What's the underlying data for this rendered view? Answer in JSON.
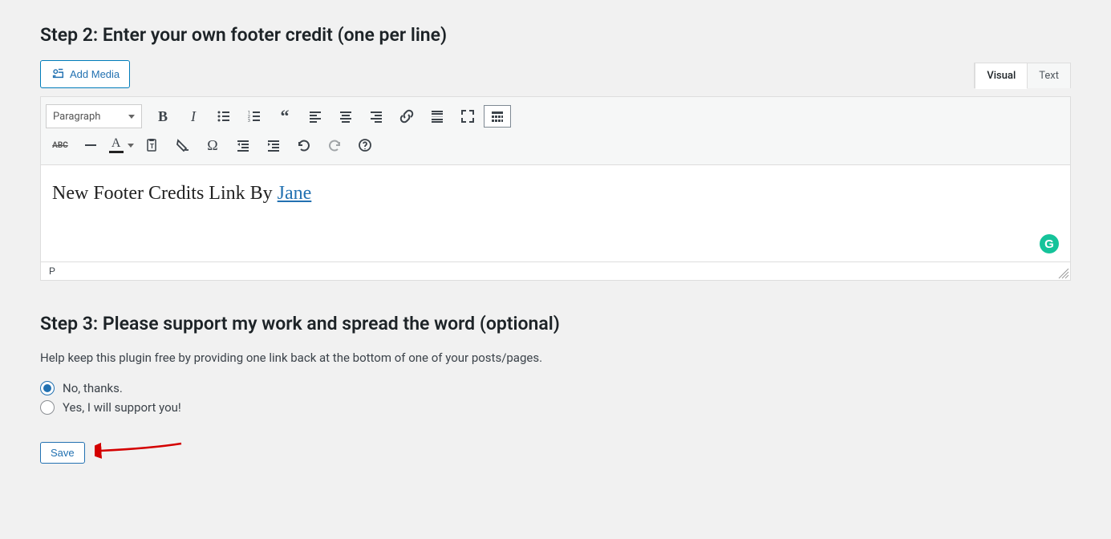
{
  "step2": {
    "heading": "Step 2: Enter your own footer credit (one per line)",
    "add_media_label": "Add Media",
    "tabs": {
      "visual": "Visual",
      "text": "Text"
    },
    "format_select": "Paragraph",
    "content_prefix": "New Footer Credits Link By ",
    "content_link": "Jane",
    "status_path": "P",
    "grammarly_glyph": "G"
  },
  "toolbar_row1": {
    "bold": "B",
    "italic": "I"
  },
  "toolbar_row2": {
    "abc": "ABC",
    "textcolor_letter": "A",
    "omega": "Ω"
  },
  "step3": {
    "heading": "Step 3: Please support my work and spread the word (optional)",
    "help_text": "Help keep this plugin free by providing one link back at the bottom of one of your posts/pages.",
    "options": {
      "no": "No, thanks.",
      "yes": "Yes, I will support you!"
    },
    "selected": "no",
    "save_label": "Save"
  },
  "colors": {
    "accent": "#2271b1",
    "arrow": "#d40000"
  }
}
